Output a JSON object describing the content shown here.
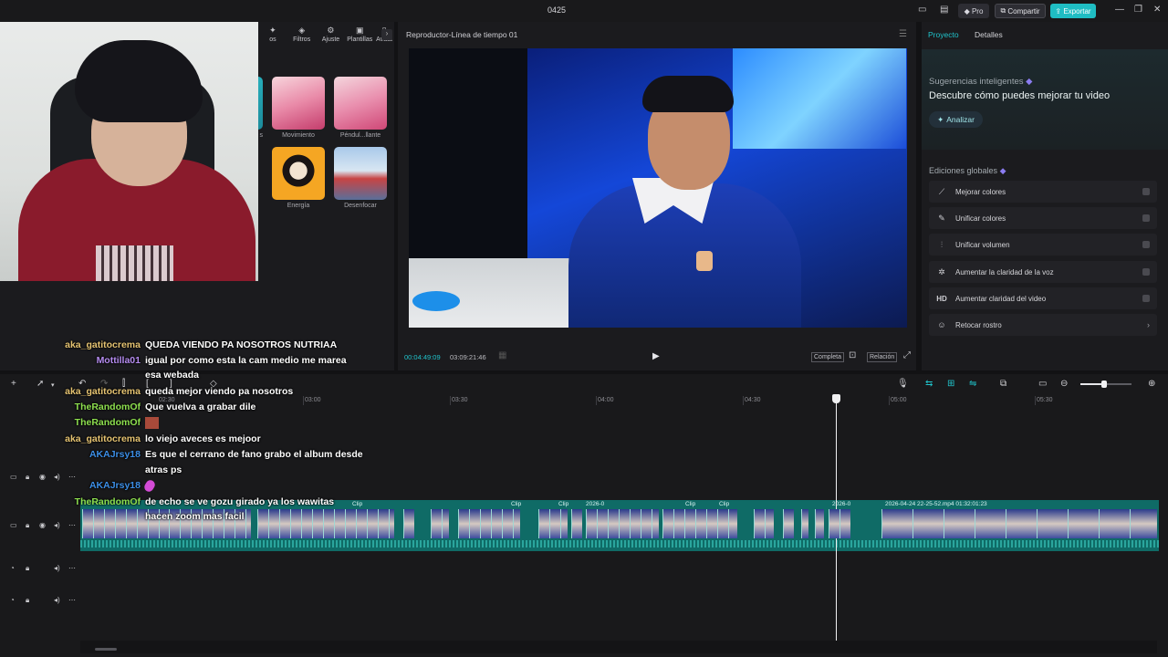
{
  "window": {
    "title": "0425"
  },
  "topbar": {
    "pro_label": "Pro",
    "share_label": "Compartir",
    "export_label": "Exportar"
  },
  "media": {
    "toolbar": [
      {
        "label": "os",
        "icon": "bulb-icon"
      },
      {
        "label": "Filtros",
        "icon": "filter-icon"
      },
      {
        "label": "Ajuste",
        "icon": "adjust-icon"
      },
      {
        "label": "Plantillas",
        "icon": "template-icon"
      },
      {
        "label": "Avata",
        "icon": "avatar-icon"
      }
    ],
    "effects": [
      {
        "label": "s"
      },
      {
        "label": "Movimiento"
      },
      {
        "label": "Péndul...llante"
      },
      {
        "label": "Energía"
      },
      {
        "label": "Desenfocar"
      }
    ]
  },
  "chat": [
    {
      "user": "aka_gatitocrema",
      "color": "#e5c372",
      "msg": "QUEDA VIENDO PA NOSOTROS NUTRIAA"
    },
    {
      "user": "Mottilla01",
      "color": "#b58cf0",
      "msg": "igual por como esta la cam medio me marea"
    },
    {
      "user": "",
      "color": "#ffffff",
      "msg": "esa webada"
    },
    {
      "user": "aka_gatitocrema",
      "color": "#e5c372",
      "msg": "queda mejor viendo pa nosotros"
    },
    {
      "user": "TheRandomOf",
      "color": "#8ee04f",
      "msg": "Que vuelva a grabar dile"
    },
    {
      "user": "TheRandomOf",
      "color": "#8ee04f",
      "msg": ""
    },
    {
      "user": "aka_gatitocrema",
      "color": "#e5c372",
      "msg": "lo viejo aveces es mejoor"
    },
    {
      "user": "AKAJrsy18",
      "color": "#3c8ee6",
      "msg": "Es que el cerrano de fano grabo el album desde"
    },
    {
      "user": "",
      "color": "#ffffff",
      "msg": "atras ps"
    },
    {
      "user": "AKAJrsy18",
      "color": "#3c8ee6",
      "msg": ""
    },
    {
      "user": "TheRandomOf",
      "color": "#8ee04f",
      "msg": "de echo se ve gozu girado ya los wawitas"
    },
    {
      "user": "",
      "color": "#ffffff",
      "msg": "hacen zoom mas facil"
    }
  ],
  "player": {
    "title": "Reproductor-Línea de tiempo 01",
    "time_current": "00:04:49:09",
    "time_total": "03:09:21:46",
    "full_label": "Completa",
    "ratio_label": "Relación"
  },
  "right_panel": {
    "tab_project": "Proyecto",
    "tab_details": "Detalles",
    "suggestions_title": "Sugerencias inteligentes",
    "suggestions_headline": "Descubre cómo puedes mejorar tu video",
    "analyze_label": "Analizar",
    "global_title": "Ediciones globales",
    "items": [
      {
        "label": "Mejorar colores",
        "icon": "wand-icon"
      },
      {
        "label": "Unificar colores",
        "icon": "brush-icon"
      },
      {
        "label": "Unificar volumen",
        "icon": "sliders-icon"
      },
      {
        "label": "Aumentar la claridad de la voz",
        "icon": "sparkle-icon"
      },
      {
        "label": "Aumentar claridad del video",
        "icon": "hd-icon"
      },
      {
        "label": "Retocar rostro",
        "icon": "face-icon"
      }
    ]
  },
  "timeline": {
    "ruler": [
      "03:00",
      "03:30",
      "04:00",
      "04:30",
      "05:00",
      "05:30"
    ],
    "ruler_left": "02:30",
    "clip_labels": [
      "Clip",
      "Clip",
      "Clip",
      "Clip",
      "Clip",
      "2026-0",
      "2026-0",
      "2026-04-24 22-25-52.mp4  01:32:01:23"
    ]
  },
  "colors": {
    "accent": "#20c3cb",
    "clip": "#0f6b66"
  }
}
